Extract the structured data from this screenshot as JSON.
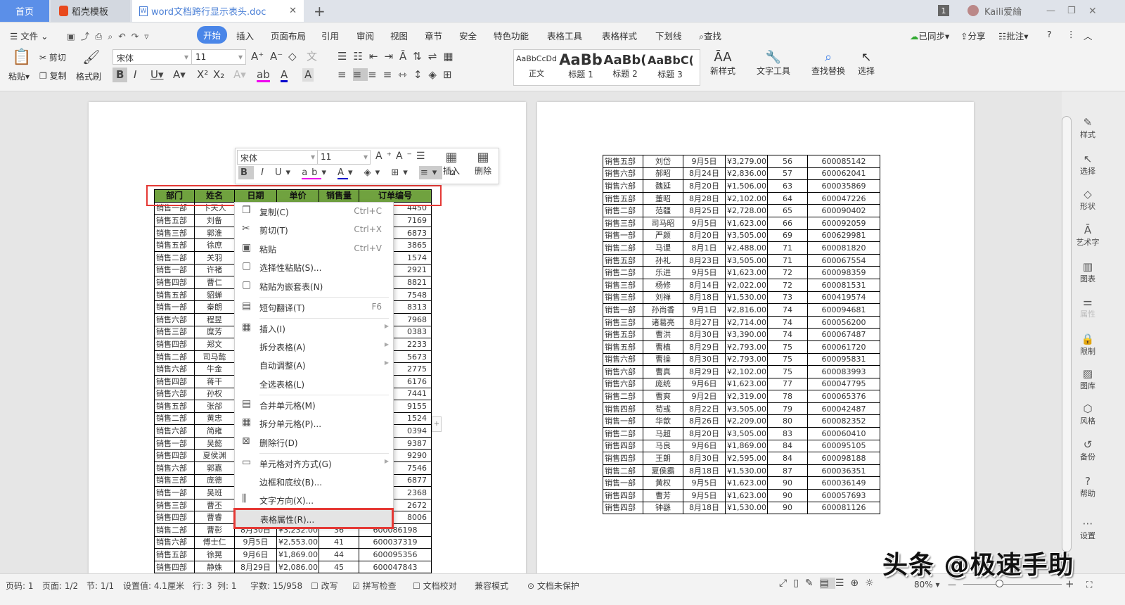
{
  "tabs": {
    "home": "首页",
    "template": "稻壳模板",
    "doc": "word文档跨行显示表头.doc",
    "new_tab": "+",
    "close": "✕"
  },
  "titlebar": {
    "badge": "1",
    "user": "Kaili爱綸"
  },
  "menu": {
    "file": "文件",
    "items": [
      "开始",
      "插入",
      "页面布局",
      "引用",
      "审阅",
      "视图",
      "章节",
      "安全",
      "特色功能",
      "表格工具",
      "表格样式",
      "下划线"
    ],
    "search": "查找",
    "sync": "已同步",
    "share": "分享",
    "comment": "批注"
  },
  "ribbon": {
    "paste": "粘贴",
    "cut": "剪切",
    "copy": "复制",
    "format_painter": "格式刷",
    "font": "宋体",
    "size": "11",
    "styles": [
      {
        "preview": "AaBbCcDd",
        "name": "正文"
      },
      {
        "preview": "AaBb",
        "name": "标题 1"
      },
      {
        "preview": "AaBb(",
        "name": "标题 2"
      },
      {
        "preview": "AaBbC(",
        "name": "标题 3"
      }
    ],
    "new_style": "新样式",
    "text_tools": "文字工具",
    "find_replace": "查找替换",
    "select": "选择"
  },
  "mini_toolbar": {
    "font": "宋体",
    "size": "11",
    "insert": "插入",
    "delete": "删除"
  },
  "table_header": [
    "部门",
    "姓名",
    "日期",
    "单价",
    "销售量",
    "订单编号"
  ],
  "left_rows": [
    [
      "销售一部",
      "卞天人",
      "",
      "",
      "",
      "4450"
    ],
    [
      "销售五部",
      "刘备",
      "",
      "",
      "",
      "7169"
    ],
    [
      "销售三部",
      "郭淮",
      "",
      "",
      "",
      "6873"
    ],
    [
      "销售五部",
      "徐庶",
      "",
      "",
      "",
      "3865"
    ],
    [
      "销售二部",
      "关羽",
      "",
      "",
      "",
      "1574"
    ],
    [
      "销售一部",
      "许褚",
      "",
      "",
      "",
      "2921"
    ],
    [
      "销售四部",
      "曹仁",
      "",
      "",
      "",
      "8821"
    ],
    [
      "销售五部",
      "貂蝉",
      "",
      "",
      "",
      "7548"
    ],
    [
      "销售一部",
      "秦朗",
      "",
      "",
      "",
      "8313"
    ],
    [
      "销售六部",
      "程昱",
      "",
      "",
      "",
      "7968"
    ],
    [
      "销售三部",
      "糜芳",
      "",
      "",
      "",
      "0383"
    ],
    [
      "销售四部",
      "郑文",
      "",
      "",
      "",
      "2233"
    ],
    [
      "销售二部",
      "司马懿",
      "",
      "",
      "",
      "5673"
    ],
    [
      "销售六部",
      "牛金",
      "",
      "",
      "",
      "2775"
    ],
    [
      "销售四部",
      "蒋干",
      "",
      "",
      "",
      "6176"
    ],
    [
      "销售六部",
      "孙权",
      "",
      "",
      "",
      "7441"
    ],
    [
      "销售五部",
      "张郃",
      "",
      "",
      "",
      "9155"
    ],
    [
      "销售二部",
      "黄忠",
      "",
      "",
      "",
      "1524"
    ],
    [
      "销售六部",
      "简雍",
      "",
      "",
      "",
      "0394"
    ],
    [
      "销售一部",
      "吴懿",
      "",
      "",
      "",
      "9387"
    ],
    [
      "销售四部",
      "夏侯渊",
      "",
      "",
      "",
      "9290"
    ],
    [
      "销售六部",
      "郭嘉",
      "",
      "",
      "",
      "7546"
    ],
    [
      "销售三部",
      "庞德",
      "",
      "",
      "",
      "6877"
    ],
    [
      "销售一部",
      "吴班",
      "",
      "",
      "",
      "2368"
    ],
    [
      "销售三部",
      "曹丕",
      "",
      "",
      "",
      "2672"
    ],
    [
      "销售四部",
      "曹睿",
      "",
      "",
      "",
      "8006"
    ],
    [
      "销售二部",
      "曹彰",
      "8月30日",
      "¥3,232.00",
      "36",
      "600086198"
    ],
    [
      "销售六部",
      "傅士仁",
      "9月5日",
      "¥2,553.00",
      "41",
      "600037319"
    ],
    [
      "销售五部",
      "徐晃",
      "9月6日",
      "¥1,869.00",
      "44",
      "600095356"
    ],
    [
      "销售四部",
      "静姝",
      "8月29日",
      "¥2,086.00",
      "45",
      "600047843"
    ]
  ],
  "right_rows": [
    [
      "销售五部",
      "刘岱",
      "9月5日",
      "¥3,279.00",
      "56",
      "600085142"
    ],
    [
      "销售六部",
      "郝昭",
      "8月24日",
      "¥2,836.00",
      "57",
      "600062041"
    ],
    [
      "销售六部",
      "魏延",
      "8月20日",
      "¥1,506.00",
      "63",
      "600035869"
    ],
    [
      "销售五部",
      "董昭",
      "8月28日",
      "¥2,102.00",
      "64",
      "600047226"
    ],
    [
      "销售二部",
      "范疆",
      "8月25日",
      "¥2,728.00",
      "65",
      "600090402"
    ],
    [
      "销售三部",
      "司马昭",
      "9月5日",
      "¥1,623.00",
      "66",
      "600092059"
    ],
    [
      "销售一部",
      "严颜",
      "8月20日",
      "¥3,505.00",
      "69",
      "600629981"
    ],
    [
      "销售二部",
      "马谡",
      "8月1日",
      "¥2,488.00",
      "71",
      "600081820"
    ],
    [
      "销售五部",
      "孙礼",
      "8月23日",
      "¥3,505.00",
      "71",
      "600067554"
    ],
    [
      "销售二部",
      "乐进",
      "9月5日",
      "¥1,623.00",
      "72",
      "600098359"
    ],
    [
      "销售三部",
      "杨修",
      "8月14日",
      "¥2,022.00",
      "72",
      "600081531"
    ],
    [
      "销售三部",
      "刘禅",
      "8月18日",
      "¥1,530.00",
      "73",
      "600419574"
    ],
    [
      "销售一部",
      "孙尚香",
      "9月1日",
      "¥2,816.00",
      "74",
      "600094681"
    ],
    [
      "销售三部",
      "诸葛亮",
      "8月27日",
      "¥2,714.00",
      "74",
      "600056200"
    ],
    [
      "销售五部",
      "曹洪",
      "8月30日",
      "¥3,390.00",
      "74",
      "600067487"
    ],
    [
      "销售五部",
      "曹植",
      "8月29日",
      "¥2,793.00",
      "75",
      "600061720"
    ],
    [
      "销售六部",
      "曹操",
      "8月30日",
      "¥2,793.00",
      "75",
      "600095831"
    ],
    [
      "销售六部",
      "曹真",
      "8月29日",
      "¥2,102.00",
      "75",
      "600083993"
    ],
    [
      "销售六部",
      "庞统",
      "9月6日",
      "¥1,623.00",
      "77",
      "600047795"
    ],
    [
      "销售二部",
      "曹爽",
      "9月2日",
      "¥2,319.00",
      "78",
      "600065376"
    ],
    [
      "销售四部",
      "荀彧",
      "8月22日",
      "¥3,505.00",
      "79",
      "600042487"
    ],
    [
      "销售一部",
      "华歆",
      "8月26日",
      "¥2,209.00",
      "80",
      "600082352"
    ],
    [
      "销售二部",
      "马超",
      "8月20日",
      "¥3,505.00",
      "83",
      "600060410"
    ],
    [
      "销售四部",
      "马良",
      "9月6日",
      "¥1,869.00",
      "84",
      "600095105"
    ],
    [
      "销售四部",
      "王朗",
      "8月30日",
      "¥2,595.00",
      "84",
      "600098188"
    ],
    [
      "销售二部",
      "夏侯霸",
      "8月18日",
      "¥1,530.00",
      "87",
      "600036351"
    ],
    [
      "销售一部",
      "黄权",
      "9月5日",
      "¥1,623.00",
      "90",
      "600036149"
    ],
    [
      "销售四部",
      "曹芳",
      "9月5日",
      "¥1,623.00",
      "90",
      "600057693"
    ],
    [
      "销售四部",
      "钟繇",
      "8月18日",
      "¥1,530.00",
      "90",
      "600081126"
    ]
  ],
  "context_menu": [
    {
      "icon": "❐",
      "label": "复制(C)",
      "shortcut": "Ctrl+C"
    },
    {
      "icon": "✂",
      "label": "剪切(T)",
      "shortcut": "Ctrl+X"
    },
    {
      "icon": "▣",
      "label": "粘贴",
      "shortcut": "Ctrl+V"
    },
    {
      "icon": "▢",
      "label": "选择性粘贴(S)..."
    },
    {
      "icon": "▢",
      "label": "粘贴为嵌套表(N)",
      "sep_after": true
    },
    {
      "icon": "▤",
      "label": "短句翻译(T)",
      "shortcut": "F6",
      "sep_after": true
    },
    {
      "icon": "▦",
      "label": "插入(I)",
      "submenu": true
    },
    {
      "label": "拆分表格(A)",
      "submenu": true
    },
    {
      "label": "自动调整(A)",
      "submenu": true
    },
    {
      "label": "全选表格(L)",
      "sep_after": true
    },
    {
      "icon": "▤",
      "label": "合并单元格(M)"
    },
    {
      "icon": "▦",
      "label": "拆分单元格(P)..."
    },
    {
      "icon": "⊠",
      "label": "删除行(D)",
      "sep_after": true
    },
    {
      "icon": "▭",
      "label": "单元格对齐方式(G)",
      "submenu": true
    },
    {
      "label": "边框和底纹(B)..."
    },
    {
      "icon": "⫼",
      "label": "文字方向(X)..."
    },
    {
      "label": "表格属性(R)...",
      "highlighted": true
    }
  ],
  "sidebar": [
    "样式",
    "选择",
    "形状",
    "艺术字",
    "图表",
    "属性",
    "限制",
    "图库",
    "风格",
    "备份",
    "帮助",
    "设置"
  ],
  "status": {
    "page": "页码: 1",
    "pages": "页面: 1/2",
    "section": "节: 1/1",
    "setting": "设置值: 4.1厘米",
    "row": "行: 3",
    "col": "列: 1",
    "words": "字数: 15/958",
    "overwrite": "改写",
    "spell": "拼写检查",
    "proof": "文档校对",
    "compat": "兼容模式",
    "protect": "文档未保护",
    "zoom": "80%"
  },
  "watermark": "头条 @极速手助",
  "colors": {
    "accent": "#4a86e8",
    "header_green": "#70a23f",
    "highlight_red": "#e53935"
  }
}
